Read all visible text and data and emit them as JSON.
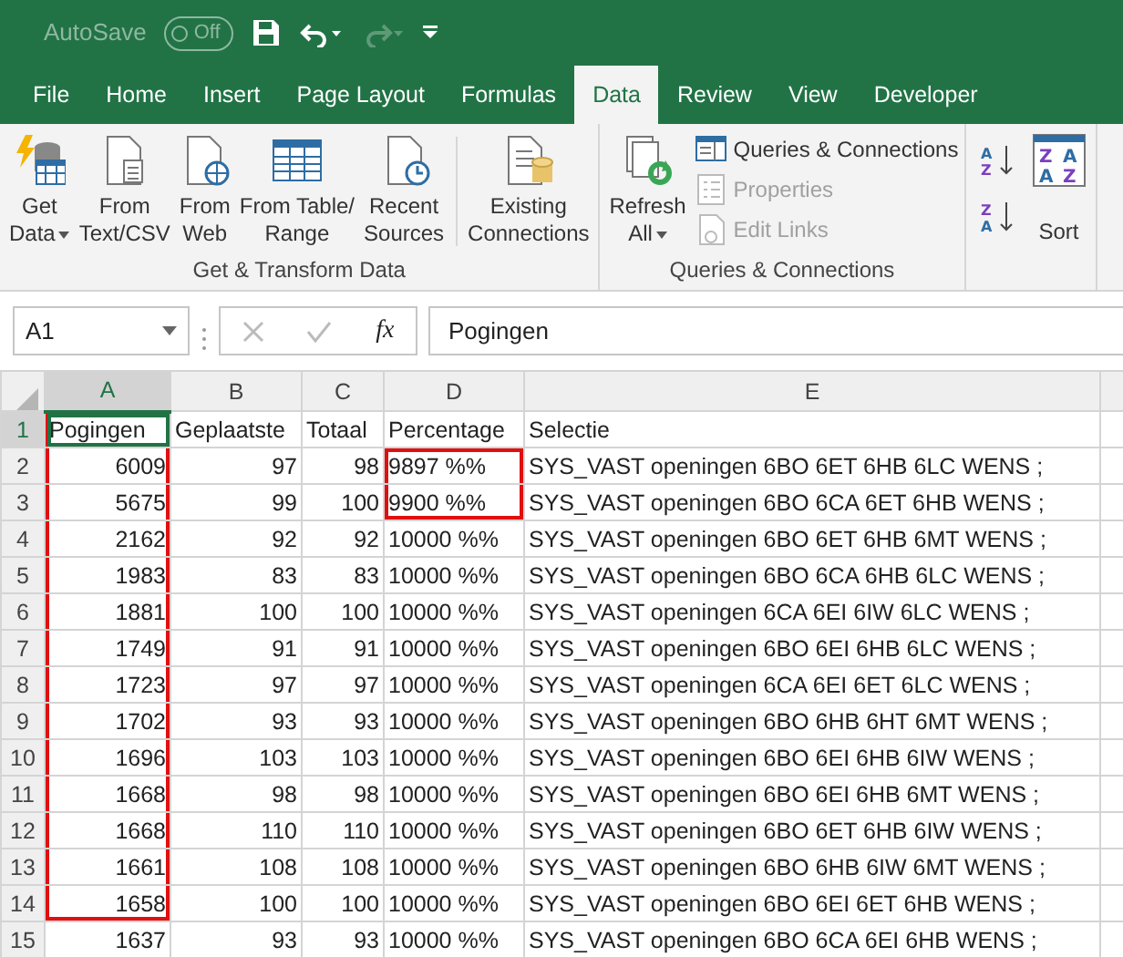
{
  "quick_access": {
    "autosave_label": "AutoSave",
    "autosave": {
      "on": false,
      "label": "Off"
    },
    "redo_disabled": true
  },
  "tabs": [
    {
      "label": "File",
      "selected": false
    },
    {
      "label": "Home",
      "selected": false
    },
    {
      "label": "Insert",
      "selected": false
    },
    {
      "label": "Page Layout",
      "selected": false
    },
    {
      "label": "Formulas",
      "selected": false
    },
    {
      "label": "Data",
      "selected": true
    },
    {
      "label": "Review",
      "selected": false
    },
    {
      "label": "View",
      "selected": false
    },
    {
      "label": "Developer",
      "selected": false
    }
  ],
  "ribbon": {
    "groups": [
      {
        "label": "Get & Transform Data",
        "items": [
          {
            "kind": "large",
            "lines": [
              "Get",
              "Data"
            ],
            "dropdown": true
          },
          {
            "kind": "large",
            "lines": [
              "From",
              "Text/CSV"
            ],
            "dropdown": false
          },
          {
            "kind": "large",
            "lines": [
              "From",
              "Web"
            ],
            "dropdown": false
          },
          {
            "kind": "large",
            "lines": [
              "From Table/",
              "Range"
            ],
            "dropdown": false
          },
          {
            "kind": "large",
            "lines": [
              "Recent",
              "Sources"
            ],
            "dropdown": false
          },
          {
            "kind": "separator"
          },
          {
            "kind": "large",
            "lines": [
              "Existing",
              "Connections"
            ],
            "dropdown": false
          }
        ]
      },
      {
        "label": "Queries & Connections",
        "items": [
          {
            "kind": "large",
            "lines": [
              "Refresh",
              "All"
            ],
            "dropdown": true
          },
          {
            "kind": "stack",
            "entries": [
              {
                "label": "Queries & Connections",
                "disabled": false
              },
              {
                "label": "Properties",
                "disabled": true
              },
              {
                "label": "Edit Links",
                "disabled": true
              }
            ]
          }
        ]
      },
      {
        "items": [
          {
            "kind": "sort-icons",
            "icons": [
              {
                "letters": [
                  "A",
                  "Z"
                ]
              },
              {
                "letters": [
                  "Z",
                  "A"
                ]
              }
            ]
          },
          {
            "kind": "sort",
            "letters": [
              "Z",
              "A",
              "A",
              "Z"
            ],
            "lines": [
              "Sort"
            ]
          }
        ]
      }
    ]
  },
  "formula_bar": {
    "name_box": "A1",
    "fx": "fx",
    "value": "Pogingen"
  },
  "grid": {
    "columns": [
      {
        "label": "A",
        "selected": true,
        "numeric": true
      },
      {
        "label": "B",
        "selected": false,
        "numeric": true
      },
      {
        "label": "C",
        "selected": false,
        "numeric": true
      },
      {
        "label": "D",
        "selected": false,
        "numeric": false
      },
      {
        "label": "E",
        "selected": false,
        "numeric": false
      }
    ],
    "rows": [
      {
        "number": "1",
        "kind": "header",
        "selected": true,
        "cells": [
          "Pogingen",
          "Geplaatste",
          "Totaal",
          "Percentage",
          "Selectie"
        ],
        "boxed": [
          true,
          false,
          false,
          false,
          false
        ]
      },
      {
        "number": "2",
        "kind": "data",
        "selected": false,
        "cells": [
          "6009",
          "97",
          "98",
          "9897 %%",
          "SYS_VAST openingen 6BO 6ET 6HB 6LC WENS ;"
        ],
        "boxed": [
          true,
          false,
          false,
          true,
          false
        ]
      },
      {
        "number": "3",
        "kind": "data",
        "selected": false,
        "cells": [
          "5675",
          "99",
          "100",
          "9900 %%",
          "SYS_VAST openingen 6BO 6CA 6ET 6HB WENS ;"
        ],
        "boxed": [
          true,
          false,
          false,
          true,
          false
        ]
      },
      {
        "number": "4",
        "kind": "data",
        "selected": false,
        "cells": [
          "2162",
          "92",
          "92",
          "10000 %%",
          "SYS_VAST openingen 6BO 6ET 6HB 6MT WENS ;"
        ],
        "boxed": [
          true,
          false,
          false,
          false,
          false
        ]
      },
      {
        "number": "5",
        "kind": "data",
        "selected": false,
        "cells": [
          "1983",
          "83",
          "83",
          "10000 %%",
          "SYS_VAST openingen 6BO 6CA 6HB 6LC WENS ;"
        ],
        "boxed": [
          true,
          false,
          false,
          false,
          false
        ]
      },
      {
        "number": "6",
        "kind": "data",
        "selected": false,
        "cells": [
          "1881",
          "100",
          "100",
          "10000 %%",
          "SYS_VAST openingen 6CA 6EI 6IW 6LC WENS ;"
        ],
        "boxed": [
          true,
          false,
          false,
          false,
          false
        ]
      },
      {
        "number": "7",
        "kind": "data",
        "selected": false,
        "cells": [
          "1749",
          "91",
          "91",
          "10000 %%",
          "SYS_VAST openingen 6BO 6EI 6HB 6LC WENS ;"
        ],
        "boxed": [
          true,
          false,
          false,
          false,
          false
        ]
      },
      {
        "number": "8",
        "kind": "data",
        "selected": false,
        "cells": [
          "1723",
          "97",
          "97",
          "10000 %%",
          "SYS_VAST openingen 6CA 6EI 6ET 6LC WENS ;"
        ],
        "boxed": [
          true,
          false,
          false,
          false,
          false
        ]
      },
      {
        "number": "9",
        "kind": "data",
        "selected": false,
        "cells": [
          "1702",
          "93",
          "93",
          "10000 %%",
          "SYS_VAST openingen 6BO 6HB 6HT 6MT WENS ;"
        ],
        "boxed": [
          true,
          false,
          false,
          false,
          false
        ]
      },
      {
        "number": "10",
        "kind": "data",
        "selected": false,
        "cells": [
          "1696",
          "103",
          "103",
          "10000 %%",
          "SYS_VAST openingen 6BO 6EI 6HB 6IW WENS ;"
        ],
        "boxed": [
          true,
          false,
          false,
          false,
          false
        ]
      },
      {
        "number": "11",
        "kind": "data",
        "selected": false,
        "cells": [
          "1668",
          "98",
          "98",
          "10000 %%",
          "SYS_VAST openingen 6BO 6EI 6HB 6MT WENS ;"
        ],
        "boxed": [
          true,
          false,
          false,
          false,
          false
        ]
      },
      {
        "number": "12",
        "kind": "data",
        "selected": false,
        "cells": [
          "1668",
          "110",
          "110",
          "10000 %%",
          "SYS_VAST openingen 6BO 6ET 6HB 6IW WENS ;"
        ],
        "boxed": [
          true,
          false,
          false,
          false,
          false
        ]
      },
      {
        "number": "13",
        "kind": "data",
        "selected": false,
        "cells": [
          "1661",
          "108",
          "108",
          "10000 %%",
          "SYS_VAST openingen 6BO 6HB 6IW 6MT WENS ;"
        ],
        "boxed": [
          true,
          false,
          false,
          false,
          false
        ]
      },
      {
        "number": "14",
        "kind": "data",
        "selected": false,
        "cells": [
          "1658",
          "100",
          "100",
          "10000 %%",
          "SYS_VAST openingen 6BO 6EI 6ET 6HB WENS ;"
        ],
        "boxed": [
          true,
          false,
          false,
          false,
          false
        ]
      },
      {
        "number": "15",
        "kind": "data",
        "selected": false,
        "cells": [
          "1637",
          "93",
          "93",
          "10000 %%",
          "SYS_VAST openingen 6BO 6CA 6EI 6HB WENS ;"
        ],
        "boxed": [
          false,
          false,
          false,
          false,
          false
        ]
      }
    ]
  }
}
